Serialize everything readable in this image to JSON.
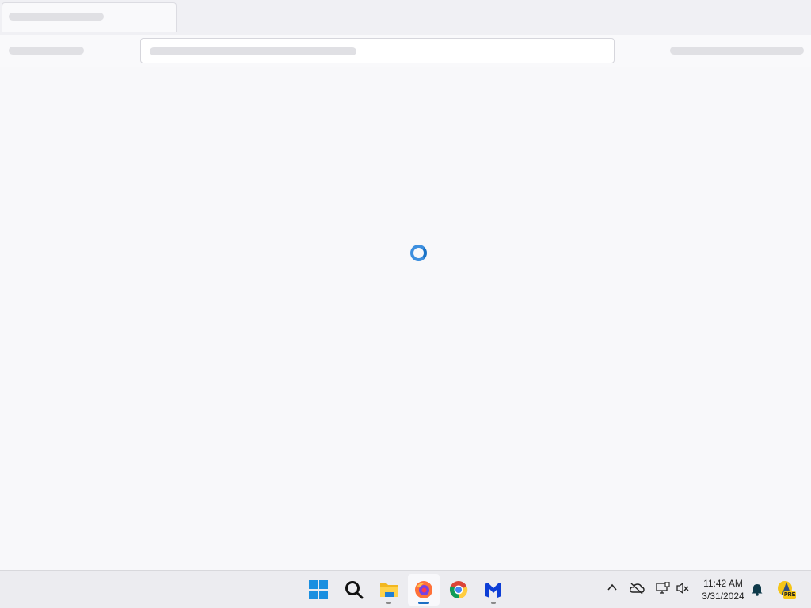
{
  "browser": {
    "tab_title": "",
    "address": "",
    "loading": true
  },
  "taskbar": {
    "apps": [
      {
        "name": "Start",
        "icon": "windows-start-icon",
        "running": false
      },
      {
        "name": "Search",
        "icon": "search-icon",
        "running": false
      },
      {
        "name": "File Explorer",
        "icon": "folder-icon",
        "running": true
      },
      {
        "name": "Firefox",
        "icon": "firefox-icon",
        "running": true,
        "active": true
      },
      {
        "name": "Chrome",
        "icon": "chrome-icon",
        "running": false
      },
      {
        "name": "Malwarebytes",
        "icon": "malwarebytes-icon",
        "running": true
      }
    ],
    "tray": {
      "time": "11:42 AM",
      "date": "3/31/2024",
      "badge": "PRE"
    }
  },
  "colors": {
    "accent": "#1b6fc4",
    "spinner": "#3d8fdf"
  }
}
